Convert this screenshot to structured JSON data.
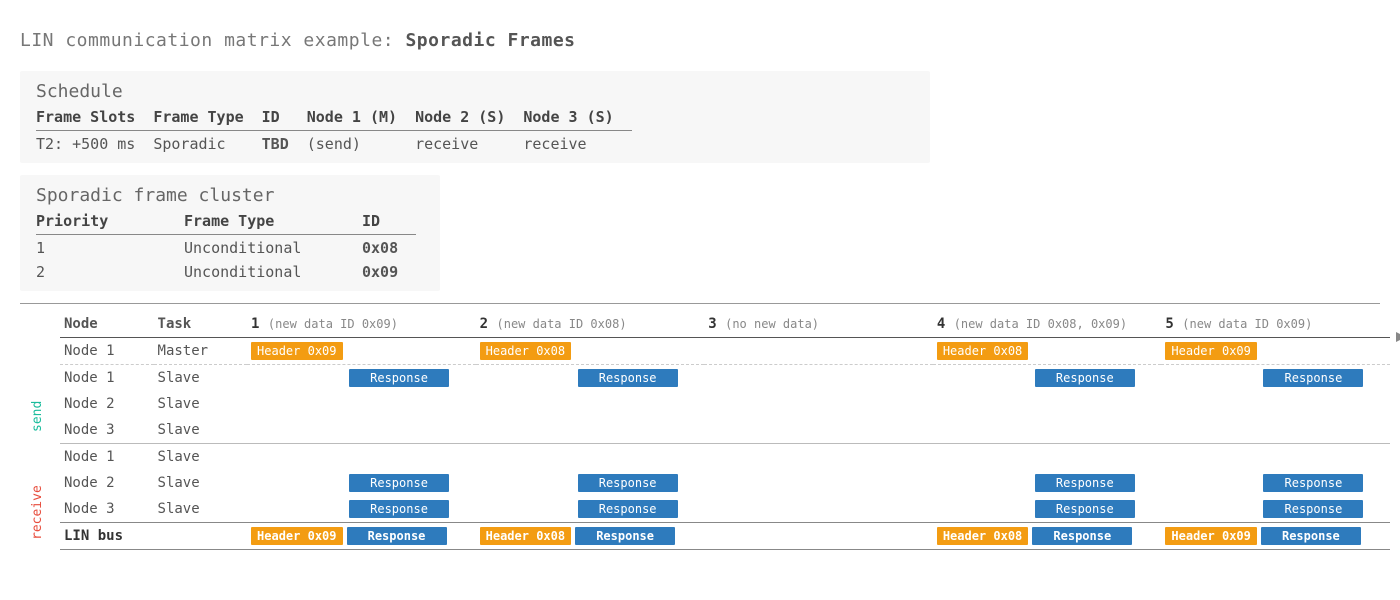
{
  "title_prefix": "LIN communication matrix example:",
  "title_bold": "Sporadic Frames",
  "schedule": {
    "heading": "Schedule",
    "headers": [
      "Frame Slots",
      "Frame Type",
      "ID",
      "Node 1 (M)",
      "Node 2 (S)",
      "Node 3 (S)"
    ],
    "row": {
      "slot": "T2: +500 ms",
      "type": "Sporadic",
      "id": "TBD",
      "n1": "(send)",
      "n2": "receive",
      "n3": "receive"
    }
  },
  "cluster": {
    "heading": "Sporadic frame cluster",
    "headers": [
      "Priority",
      "Frame Type",
      "ID"
    ],
    "rows": [
      {
        "prio": "1",
        "type": "Unconditional",
        "id": "0x08"
      },
      {
        "prio": "2",
        "type": "Unconditional",
        "id": "0x09"
      }
    ]
  },
  "diagram": {
    "col_node": "Node",
    "col_task": "Task",
    "slots": [
      {
        "num": "1",
        "note": "(new data ID 0x09)",
        "header": "Header 0x09"
      },
      {
        "num": "2",
        "note": "(new data ID 0x08)",
        "header": "Header 0x08"
      },
      {
        "num": "3",
        "note": "(no new data)",
        "header": null
      },
      {
        "num": "4",
        "note": "(new data ID 0x08, 0x09)",
        "header": "Header 0x08"
      },
      {
        "num": "5",
        "note": "(new data ID 0x09)",
        "header": "Header 0x09"
      }
    ],
    "rows": [
      {
        "node": "Node 1",
        "task": "Master",
        "kind": "master"
      },
      {
        "node": "Node 1",
        "task": "Slave",
        "kind": "send",
        "respond": true
      },
      {
        "node": "Node 2",
        "task": "Slave",
        "kind": "send",
        "respond": false
      },
      {
        "node": "Node 3",
        "task": "Slave",
        "kind": "send",
        "respond": false
      },
      {
        "node": "Node 1",
        "task": "Slave",
        "kind": "recv",
        "respond": false
      },
      {
        "node": "Node 2",
        "task": "Slave",
        "kind": "recv",
        "respond": true
      },
      {
        "node": "Node 3",
        "task": "Slave",
        "kind": "recv",
        "respond": true
      }
    ],
    "bus_label": "LIN bus",
    "response_label": "Response",
    "send_label": "send",
    "receive_label": "receive"
  }
}
